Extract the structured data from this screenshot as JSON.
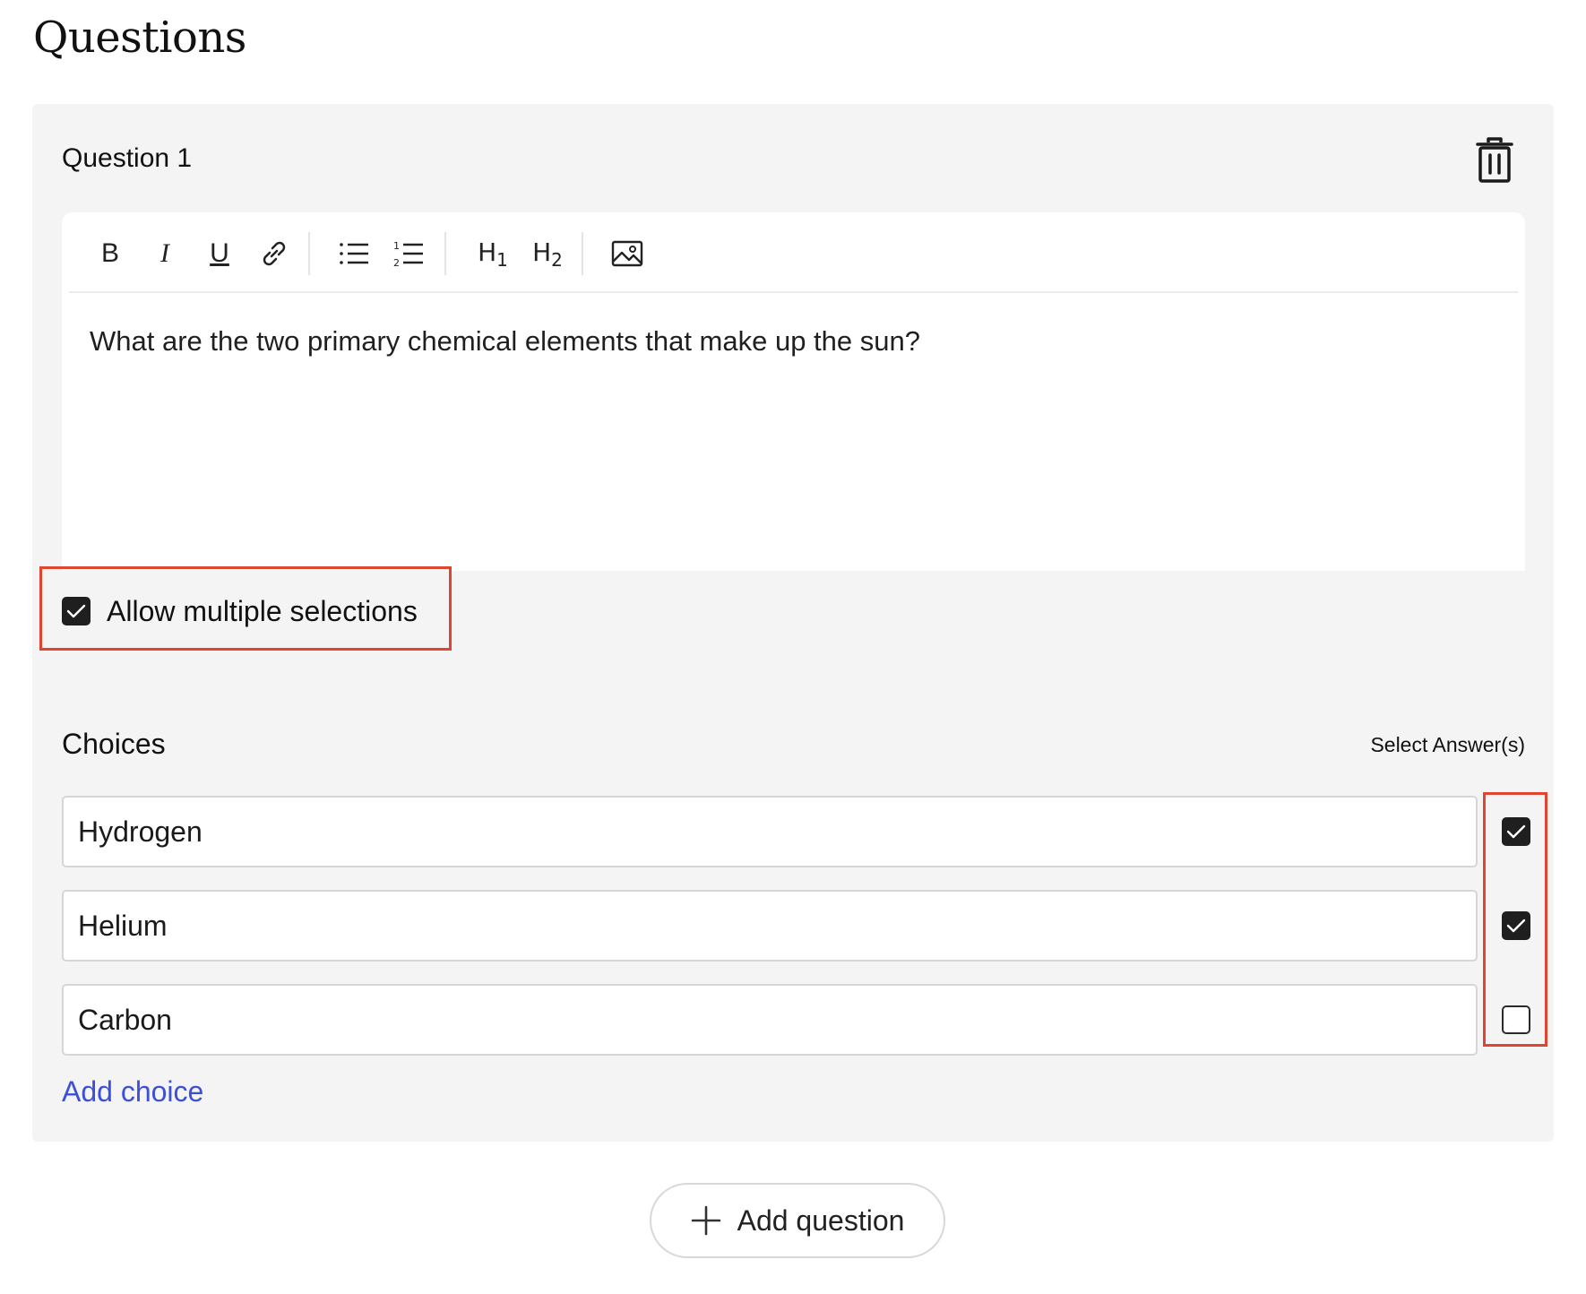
{
  "page": {
    "title": "Questions"
  },
  "question": {
    "title": "Question 1",
    "delete_icon": "trash-icon",
    "toolbar": {
      "bold": "B",
      "italic": "I",
      "underline": "U",
      "link_icon": "link-icon",
      "bullet_list_icon": "bullet-list-icon",
      "numbered_list_icon": "numbered-list-icon",
      "h1": "H",
      "h1_sub": "1",
      "h2": "H",
      "h2_sub": "2",
      "image_icon": "image-icon"
    },
    "text": "What are the two primary chemical elements that make up the sun?",
    "allow_multiple": {
      "label": "Allow multiple selections",
      "checked": true
    }
  },
  "choices": {
    "title": "Choices",
    "select_label": "Select Answer(s)",
    "items": [
      {
        "value": "Hydrogen",
        "correct": true
      },
      {
        "value": "Helium",
        "correct": true
      },
      {
        "value": "Carbon",
        "correct": false
      }
    ],
    "add_label": "Add choice"
  },
  "add_question": {
    "label": "Add question"
  },
  "colors": {
    "highlight": "#e0462f",
    "link": "#3b4fd8",
    "card_bg": "#f4f4f4"
  }
}
